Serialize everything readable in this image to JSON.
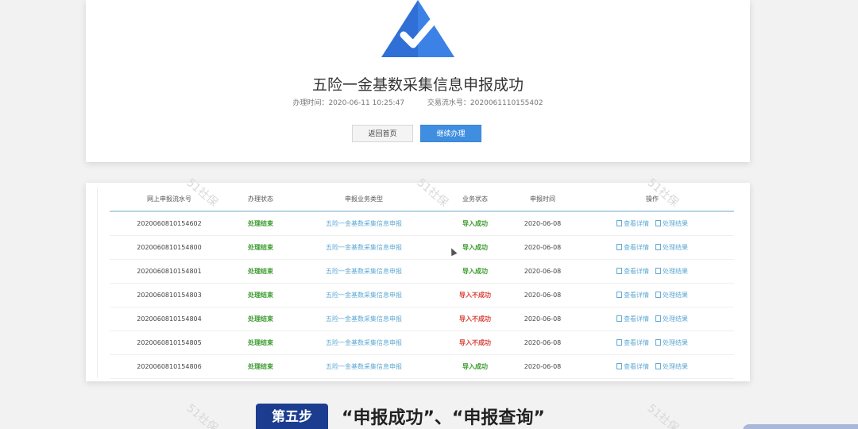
{
  "success": {
    "title": "五险一金基数采集信息申报成功",
    "time_label": "办理时间：2020-06-11 10:25:47",
    "serial_label": "交易流水号：2020061110155402",
    "back_button": "返回首页",
    "continue_button": "继续办理"
  },
  "table": {
    "headers": [
      "网上申报流水号",
      "办理状态",
      "申报业务类型",
      "业务状态",
      "申报时间",
      "操作"
    ],
    "rows": [
      {
        "id": "2020060810154602",
        "status": "处理结束",
        "type": "五险一金基数采集信息申报",
        "biz": "导入成功",
        "date": "2020-06-08"
      },
      {
        "id": "2020060810154800",
        "status": "处理结束",
        "type": "五险一金基数采集信息申报",
        "biz": "导入成功",
        "date": "2020-06-08"
      },
      {
        "id": "2020060810154801",
        "status": "处理结束",
        "type": "五险一金基数采集信息申报",
        "biz": "导入成功",
        "date": "2020-06-08"
      },
      {
        "id": "2020060810154803",
        "status": "处理结束",
        "type": "五险一金基数采集信息申报",
        "biz": "导入不成功",
        "date": "2020-06-08"
      },
      {
        "id": "2020060810154804",
        "status": "处理结束",
        "type": "五险一金基数采集信息申报",
        "biz": "导入不成功",
        "date": "2020-06-08"
      },
      {
        "id": "2020060810154805",
        "status": "处理结束",
        "type": "五险一金基数采集信息申报",
        "biz": "导入不成功",
        "date": "2020-06-08"
      },
      {
        "id": "2020060810154806",
        "status": "处理结束",
        "type": "五险一金基数采集信息申报",
        "biz": "导入成功",
        "date": "2020-06-08"
      }
    ],
    "action_view": "查看详情",
    "action_result": "处理结果"
  },
  "watermark": "51社保",
  "footer": {
    "step": "第五步",
    "caption": "“申报成功”、“申报查询”"
  },
  "colors": {
    "accent": "#3f8ee0",
    "success_green": "#3a9a2c",
    "fail_red": "#d9433a",
    "link_blue": "#5fa8d3",
    "step_navy": "#1c3d8f"
  }
}
